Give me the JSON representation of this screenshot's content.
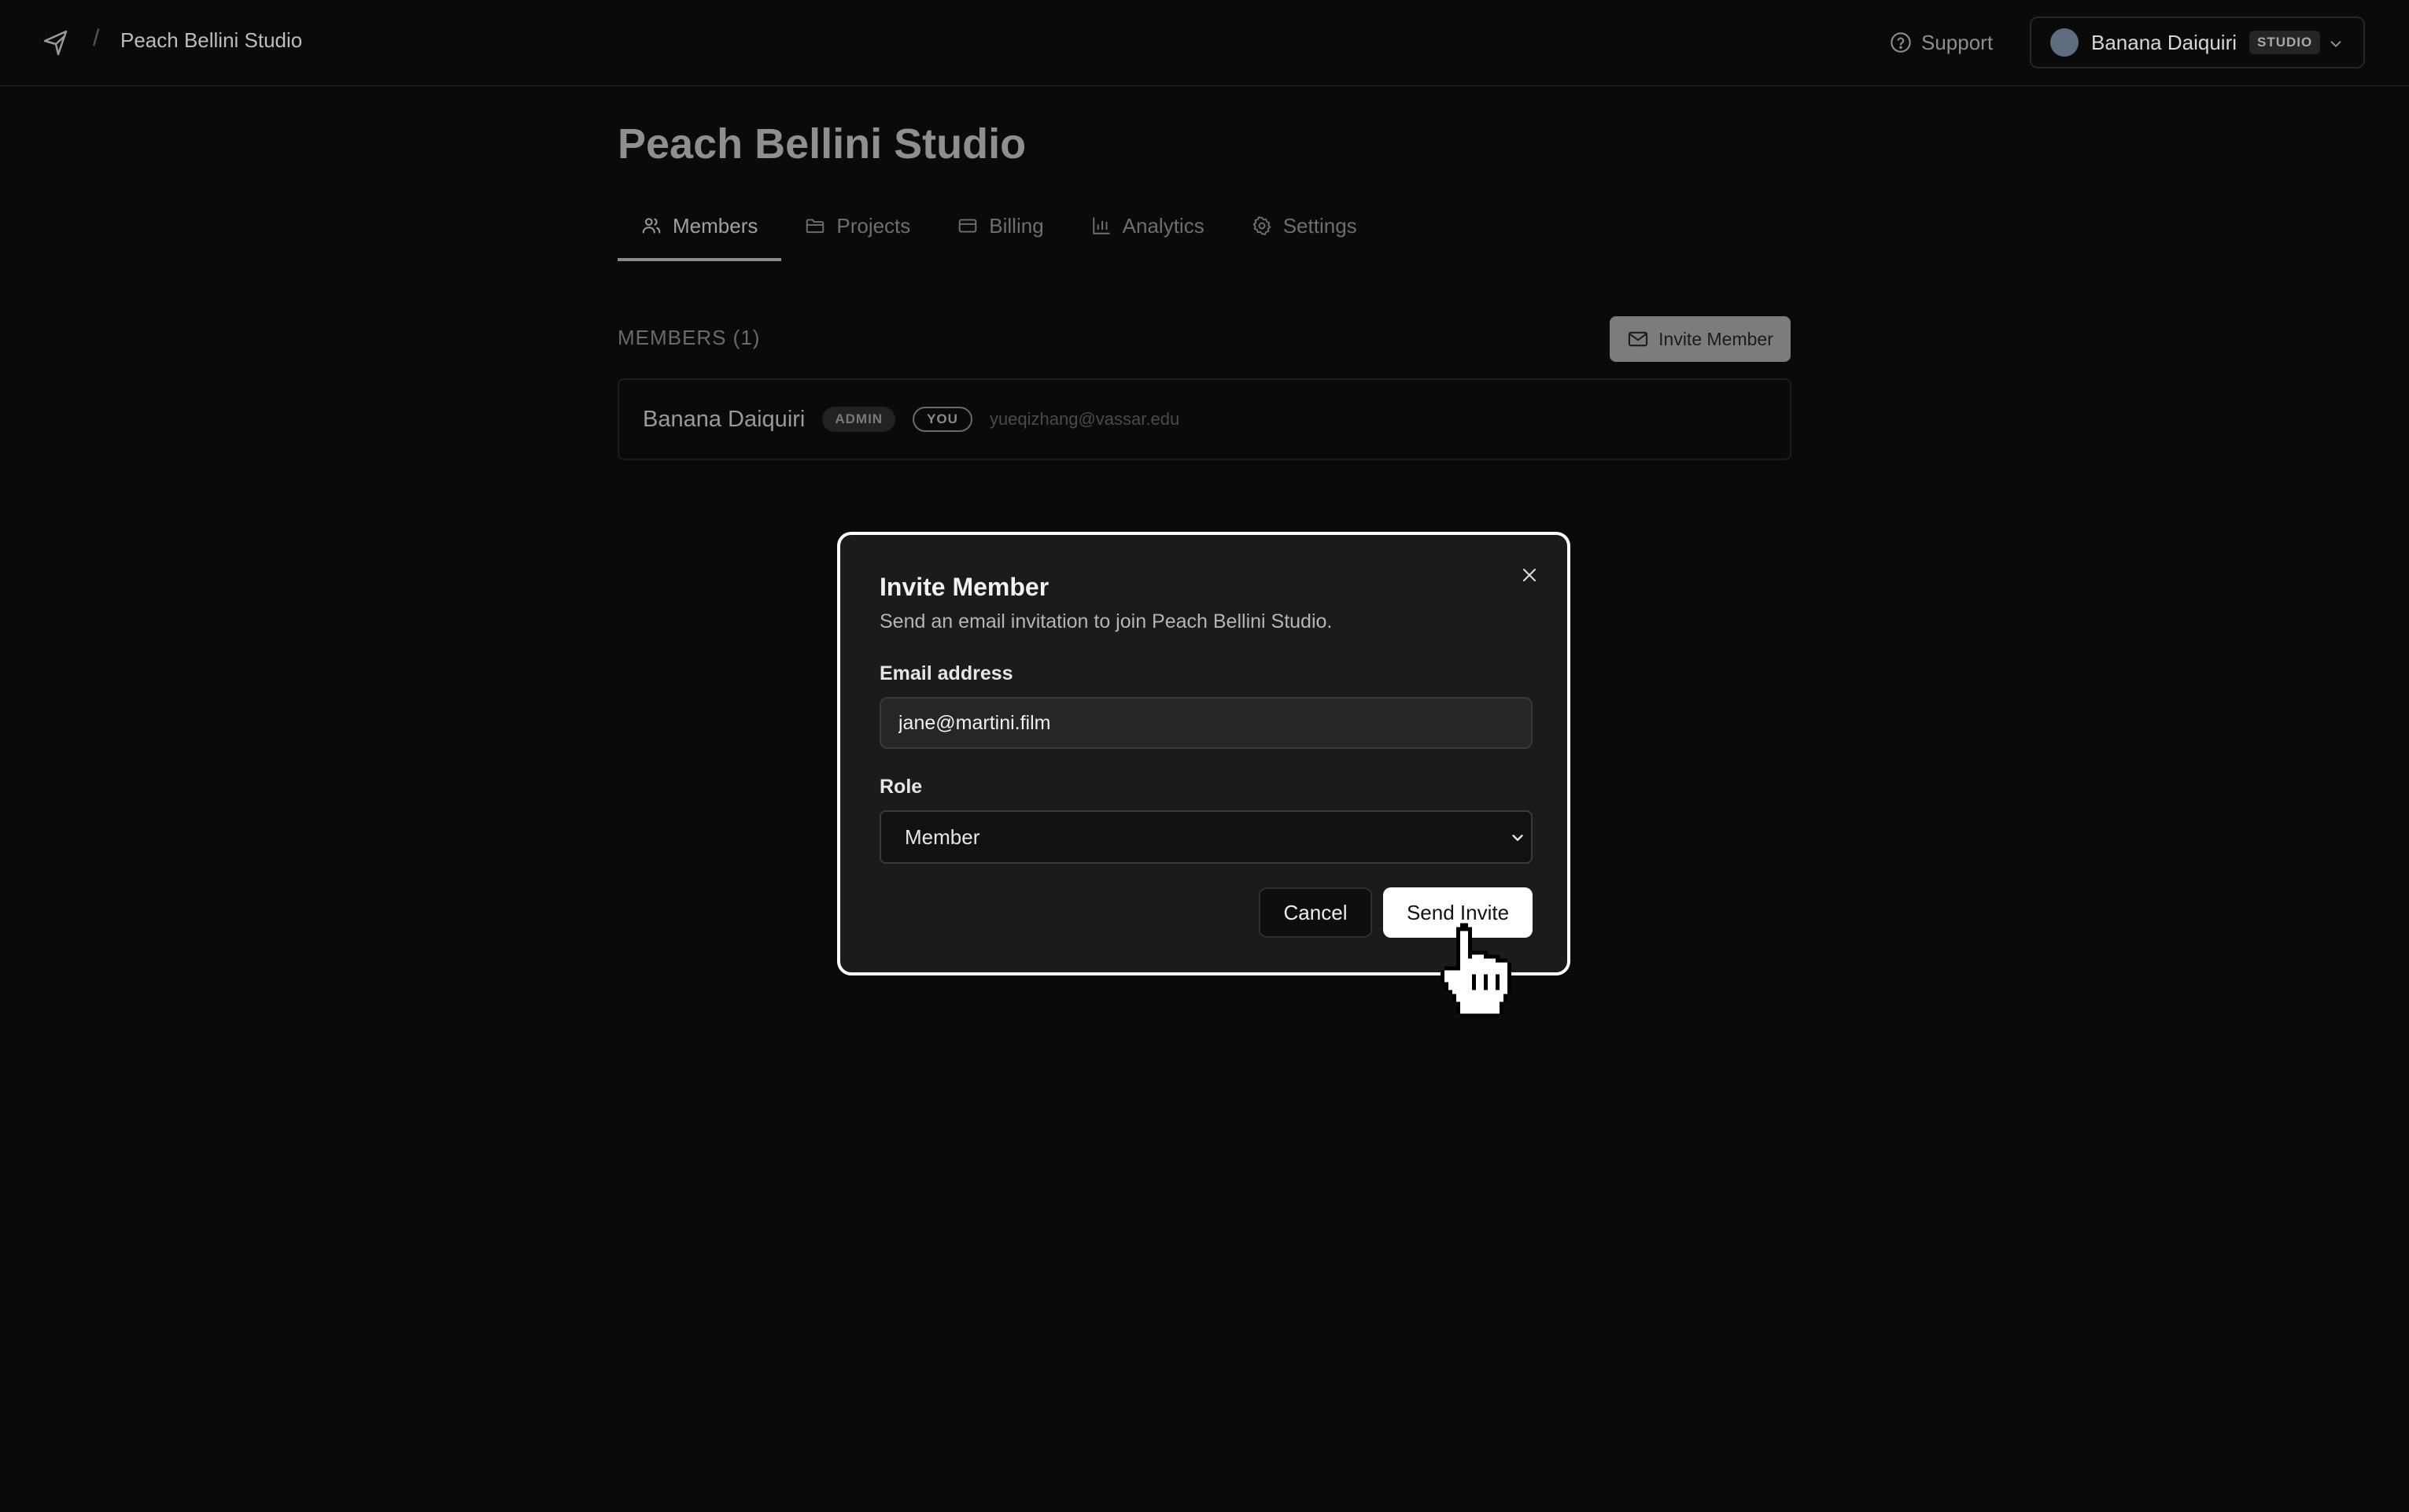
{
  "header": {
    "breadcrumb_separator": "/",
    "breadcrumb": "Peach Bellini Studio",
    "support_label": "Support",
    "account": {
      "name": "Banana Daiquiri",
      "plan_badge": "STUDIO",
      "avatar_color": "#5f6d7e"
    }
  },
  "page": {
    "title": "Peach Bellini Studio",
    "tabs": [
      {
        "label": "Members",
        "icon": "users-icon",
        "active": true
      },
      {
        "label": "Projects",
        "icon": "folder-icon",
        "active": false
      },
      {
        "label": "Billing",
        "icon": "credit-card-icon",
        "active": false
      },
      {
        "label": "Analytics",
        "icon": "bar-chart-icon",
        "active": false
      },
      {
        "label": "Settings",
        "icon": "gear-icon",
        "active": false
      }
    ]
  },
  "members": {
    "header": "MEMBERS (1)",
    "invite_button_label": "Invite Member",
    "list": [
      {
        "name": "Banana Daiquiri",
        "role_badge": "ADMIN",
        "self_badge": "YOU",
        "email": "yueqizhang@vassar.edu"
      }
    ]
  },
  "modal": {
    "title": "Invite Member",
    "subtitle": "Send an email invitation to join Peach Bellini Studio.",
    "email_label": "Email address",
    "email_value": "jane@martini.film",
    "role_label": "Role",
    "role_value": "Member",
    "cancel_label": "Cancel",
    "send_label": "Send Invite"
  },
  "colors": {
    "background": "#0a0a0a",
    "modal_background": "#1b1b1b",
    "modal_border": "#ffffff",
    "primary_button": "#ffffff"
  }
}
